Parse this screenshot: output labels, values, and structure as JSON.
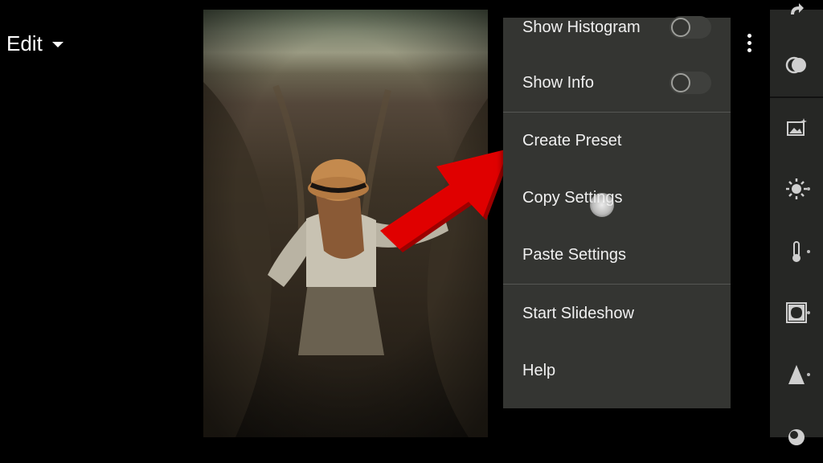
{
  "header": {
    "mode_label": "Edit"
  },
  "menu": {
    "items": [
      {
        "label": "Show Histogram",
        "toggle": "off"
      },
      {
        "label": "Show Info",
        "toggle": "off"
      },
      {
        "label": "Create Preset"
      },
      {
        "label": "Copy Settings"
      },
      {
        "label": "Paste Settings"
      },
      {
        "label": "Start Slideshow"
      },
      {
        "label": "Help"
      }
    ]
  },
  "toolbar": {
    "tools": [
      {
        "icon": "rotate-icon"
      },
      {
        "icon": "selective-masking-icon"
      },
      {
        "icon": "auto-enhance-icon"
      },
      {
        "icon": "light-icon"
      },
      {
        "icon": "color-temperature-icon"
      },
      {
        "icon": "vignette-icon"
      },
      {
        "icon": "detail-icon"
      },
      {
        "icon": "optics-icon"
      }
    ]
  },
  "colors": {
    "menu_background": "#343532",
    "overlay_arrow": "#e00000",
    "toolbar_background": "#262725"
  }
}
